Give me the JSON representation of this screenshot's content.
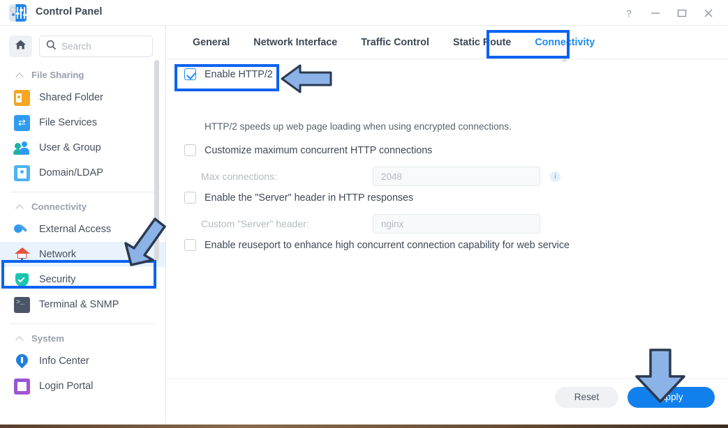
{
  "window": {
    "title": "Control Panel",
    "app_icon": "control-panel-icon",
    "controls": {
      "help": "?",
      "minimize": "–",
      "maximize": "□",
      "close": "×"
    }
  },
  "sidebar": {
    "home_button": "home-icon",
    "search": {
      "placeholder": "Search",
      "value": ""
    },
    "sections": [
      {
        "label": "File Sharing",
        "items": [
          {
            "label": "Shared Folder",
            "icon": "shared-folder-icon"
          },
          {
            "label": "File Services",
            "icon": "file-services-icon"
          },
          {
            "label": "User & Group",
            "icon": "user-group-icon"
          },
          {
            "label": "Domain/LDAP",
            "icon": "domain-ldap-icon"
          }
        ]
      },
      {
        "label": "Connectivity",
        "items": [
          {
            "label": "External Access",
            "icon": "external-access-icon"
          },
          {
            "label": "Network",
            "icon": "network-icon",
            "selected": true
          },
          {
            "label": "Security",
            "icon": "security-icon"
          },
          {
            "label": "Terminal & SNMP",
            "icon": "terminal-snmp-icon"
          }
        ]
      },
      {
        "label": "System",
        "items": [
          {
            "label": "Info Center",
            "icon": "info-center-icon"
          },
          {
            "label": "Login Portal",
            "icon": "login-portal-icon"
          }
        ]
      }
    ]
  },
  "tabs": [
    {
      "label": "General",
      "active": false
    },
    {
      "label": "Network Interface",
      "active": false
    },
    {
      "label": "Traffic Control",
      "active": false
    },
    {
      "label": "Static Route",
      "active": false
    },
    {
      "label": "Connectivity",
      "active": true
    }
  ],
  "form": {
    "http2": {
      "label": "Enable HTTP/2",
      "checked": true
    },
    "http2_hint": "HTTP/2 speeds up web page loading when using encrypted connections.",
    "max_conn_checkbox": {
      "label": "Customize maximum concurrent HTTP connections",
      "checked": false
    },
    "max_conn_field": {
      "label": "Max connections:",
      "value": "2048",
      "info_icon": "info-icon"
    },
    "server_header_checkbox": {
      "label": "Enable the \"Server\" header in HTTP responses",
      "checked": false
    },
    "server_header_field": {
      "label": "Custom \"Server\" header:",
      "value": "nginx"
    },
    "reuseport_checkbox": {
      "label": "Enable reuseport to enhance high concurrent connection capability for web service",
      "checked": false
    }
  },
  "footer": {
    "reset_label": "Reset",
    "apply_label": "Apply"
  },
  "annotations": {
    "highlight_color": "#0b62f0",
    "arrow_fill": "#8cb3e8",
    "arrow_stroke": "#2b3a4f",
    "boxes": [
      "connectivity-tab",
      "enable-http2-row",
      "network-sidebar-item"
    ],
    "arrows": [
      "arrow-to-http2",
      "arrow-to-network",
      "arrow-to-apply"
    ]
  }
}
